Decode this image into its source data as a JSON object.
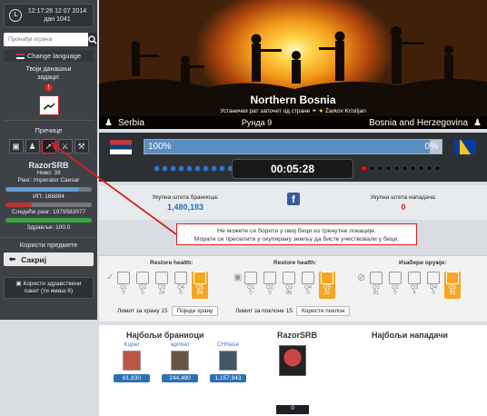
{
  "sidebar": {
    "clock_line1": "12:17:26 12 07 2014",
    "clock_line2": "дан 1041",
    "search_placeholder": "Пронађи играча",
    "change_language": "Change language",
    "tasks_label_1": "Твоји данашњи",
    "tasks_label_2": "задаци:",
    "shortcuts_title": "Пречице",
    "shortcuts": [
      "ballot-icon",
      "user-plus-icon",
      "sword-icon",
      "battle-icon",
      "hammer-icon"
    ],
    "username": "RazorSRB",
    "level": "Ниво: 39",
    "rank": "Ранг: Imperator Caesar",
    "xp": "ИП: 166884",
    "next_rank": "Следећи ранг: 1979583977",
    "health": "Здравље: 100.0",
    "xp_bar_fill": 0.85,
    "rank_bar_fill": 0.3,
    "health_bar_fill": 1.0,
    "use_items": "Користи предмете",
    "hide_label": "Сакриј",
    "health_kit_1": "Користи здравствени",
    "health_kit_2": "пакет (ти имаш 6)"
  },
  "banner": {
    "battle_title": "Northern Bosnia",
    "subtitle_prefix": "Устанички рат започет од стране",
    "subtitle_user": "Żarkov Kristijan",
    "attacker": "Serbia",
    "defender": "Bosnia and Herzegovina",
    "round": "Рунда 9"
  },
  "status": {
    "left_percent": "100%",
    "right_percent": "0%",
    "wall_fill": 0.96,
    "timer": "00:05:28"
  },
  "damage": {
    "defender_label": "Укупна штета браниоца:",
    "defender_value": "1,480,183",
    "attacker_label": "Укупна штета нападача:",
    "attacker_value": "0"
  },
  "alert": {
    "line1": "Не можете се борити у овој бици из тренутне локације.",
    "line2": "Морате се преселити у окупирану земљу да бисте учествовали у бици."
  },
  "fight": {
    "food_title": "Restore health:",
    "gift_title": "Restore health:",
    "weapon_title": "Изабери оружје:",
    "food_slots": [
      "Q1\n0",
      "Q2\n0",
      "Q3\n24",
      "Q4\n0",
      "Q5\n59"
    ],
    "gift_slots": [
      "Q1\n0",
      "Q2\n0",
      "Q3\n96",
      "Q4\n0",
      "Q5\n22"
    ],
    "weapon_slots": [
      "Q1\n91",
      "Q2\n0",
      "Q3\n4",
      "Q4\n0",
      "Q5\n55"
    ],
    "food_limit": "Лимит за храну 15",
    "eat_btn": "Поједи храну",
    "gift_limit": "Лимит за поклоне 15",
    "use_gift_btn": "Користи поклон"
  },
  "lower": {
    "top_defenders": "Најбољи браниоци",
    "me": "RazorSRB",
    "top_attackers": "Најбољи нападачи",
    "defenders": [
      {
        "name": "Kuper",
        "score": "61,830"
      },
      {
        "name": "aprilski",
        "score": "244,490"
      },
      {
        "name": "CHNase",
        "score": "1,157,943"
      }
    ],
    "my_score": "0"
  },
  "colors": {
    "alert_border": "#d32020",
    "accent_blue": "#2d6fb5",
    "selected_orange": "#f5a623"
  }
}
